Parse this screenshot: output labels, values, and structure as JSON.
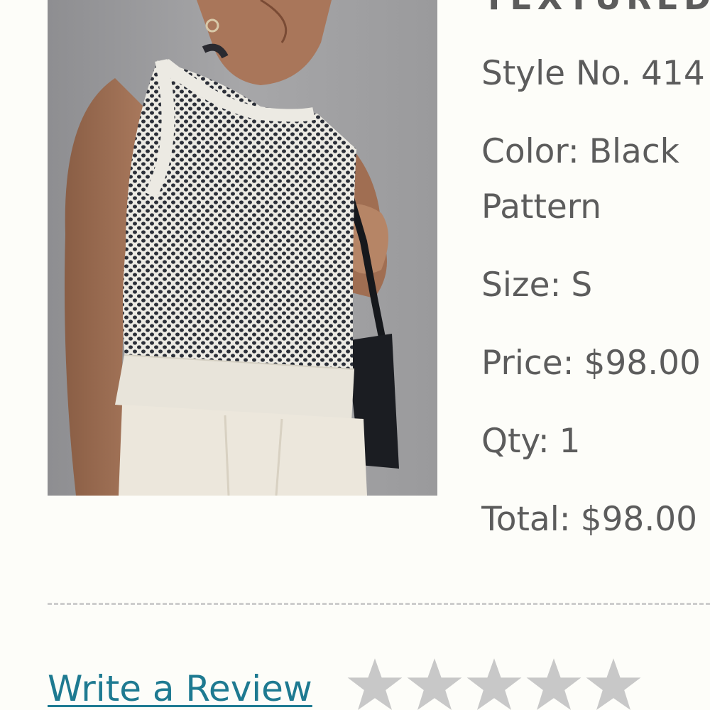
{
  "product": {
    "title": "TEXTURED",
    "image_icon": "product-photo-knit-vest"
  },
  "details": {
    "style_label": "Style No.",
    "style_value": "414",
    "color_label": "Color:",
    "color_value": "Black",
    "color_value_line2": "Pattern",
    "size_label": "Size:",
    "size_value": "S",
    "price_label": "Price:",
    "price_value": "$98.00",
    "qty_label": "Qty:",
    "qty_value": "1",
    "total_label": "Total:",
    "total_value": "$98.00"
  },
  "review": {
    "link_label": "Write a Review",
    "rating": 0,
    "max_rating": 5,
    "star_icon": "star-icon"
  },
  "colors": {
    "text": "#5c5c5c",
    "link": "#1e7a91",
    "star_empty": "#c8c8c8",
    "background": "#fdfdf9"
  }
}
